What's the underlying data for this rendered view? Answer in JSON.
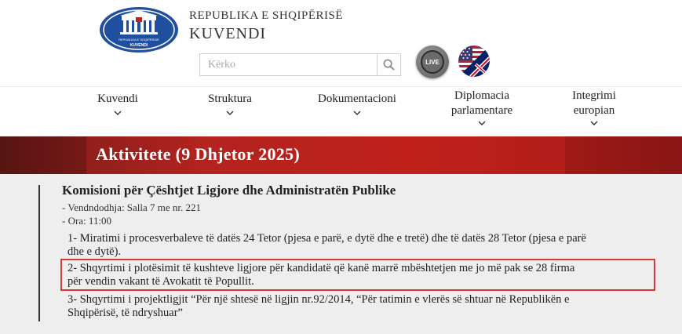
{
  "header": {
    "country_label": "REPUBLIKA E SHQIPËRISË",
    "institution": "KUVENDI",
    "logo_text": "KUVENDI",
    "logo_subtext": "REPUBLIKA E SHQIPËRISË"
  },
  "search": {
    "placeholder": "Kërko",
    "value": "",
    "icon": "search-icon"
  },
  "live": {
    "label": "LIVE"
  },
  "language": {
    "icon": "uk-us-flag-icon"
  },
  "nav": {
    "items": [
      {
        "line1": "Kuvendi",
        "line2": ""
      },
      {
        "line1": "Struktura",
        "line2": ""
      },
      {
        "line1": "Dokumentacioni",
        "line2": ""
      },
      {
        "line1": "Diplomacia",
        "line2": "parlamentare"
      },
      {
        "line1": "Integrimi",
        "line2": "europian"
      }
    ]
  },
  "banner": {
    "title": "Aktivitete (9 Dhjetor 2025)"
  },
  "activity": {
    "committee": "Komisioni për Çështjet Ligjore dhe Administratën Publike",
    "location": "- Vendndodhja: Salla 7 me nr. 221",
    "time": "- Ora: 11:00",
    "agenda": [
      {
        "line1": "1- Miratimi i procesverbaleve të datës 24 Tetor (pjesa e parë, e dytë dhe e tretë) dhe të datës 28 Tetor (pjesa e parë",
        "line2": "dhe e dytë)."
      },
      {
        "line1": "2- Shqyrtimi i plotësimit të kushteve ligjore për kandidatë që kanë marrë mbështetjen me jo më pak se 28 firma",
        "line2": "për vendin vakant të Avokatit të Popullit."
      },
      {
        "line1": "3- Shqyrtimi i projektligjit “Për një shtesë në ligjin nr.92/2014, “Për tatimin e vlerës së shtuar në Republikën e",
        "line2": "Shqipërisë, të ndryshuar”"
      }
    ]
  },
  "colors": {
    "banner_red": "#c0211d",
    "highlight_border": "#d43a32",
    "content_bg": "#efeeee",
    "logo_blue": "#1f4f9e"
  }
}
